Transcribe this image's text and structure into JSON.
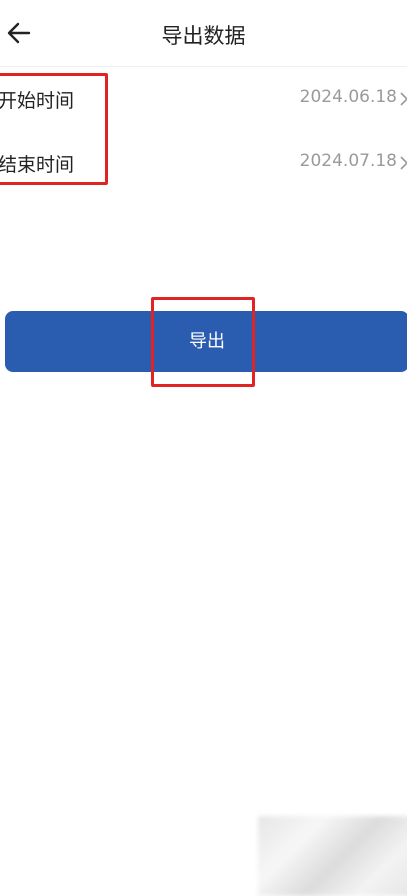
{
  "header": {
    "back_icon": "arrow-left-icon",
    "title": "导出数据"
  },
  "form": {
    "start": {
      "label": "开始时间",
      "value": "2024.06.18",
      "chevron_icon": "chevron-right-icon"
    },
    "end": {
      "label": "结束时间",
      "value": "2024.07.18",
      "chevron_icon": "chevron-right-icon"
    }
  },
  "export_button": {
    "label": "导出"
  },
  "colors": {
    "primary": "#2a5db0",
    "annotation_red": "#e02424",
    "value_gray": "#9a9a9a"
  }
}
